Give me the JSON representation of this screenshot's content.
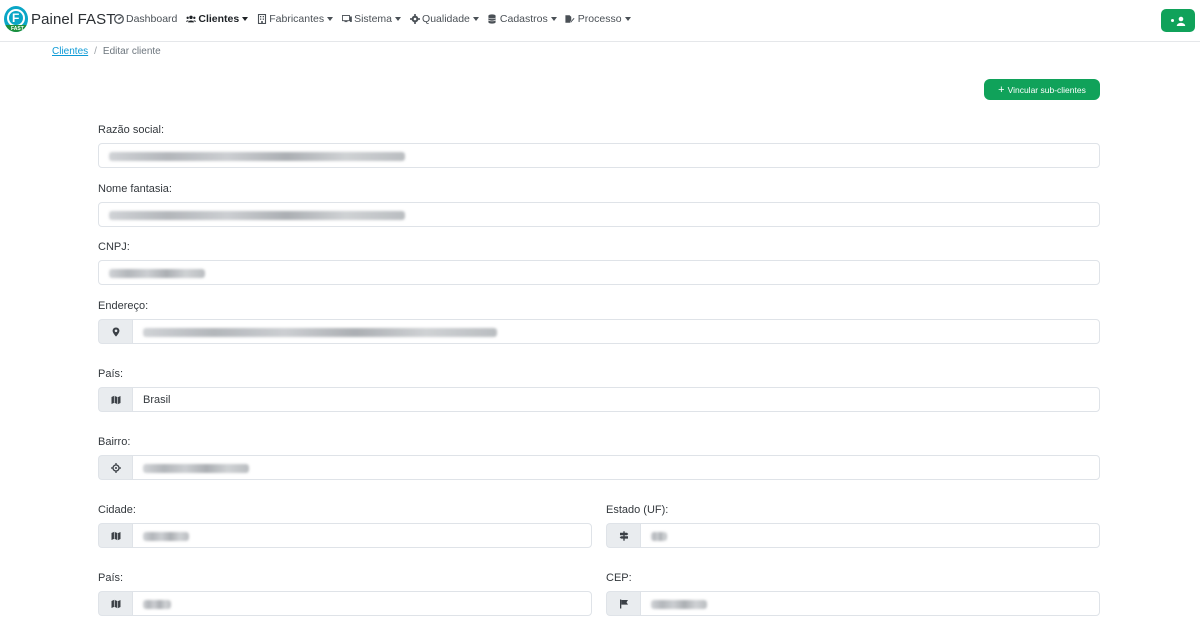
{
  "brand": {
    "name": "Painel FAST",
    "logo_letter": "F",
    "logo_small": "FAST"
  },
  "nav": [
    {
      "label": "Dashboard",
      "icon": "gauge-icon",
      "dropdown": false,
      "active": false
    },
    {
      "label": "Clientes",
      "icon": "users-icon",
      "dropdown": true,
      "active": true
    },
    {
      "label": "Fabricantes",
      "icon": "building-icon",
      "dropdown": true,
      "active": false
    },
    {
      "label": "Sistema",
      "icon": "monitor-icon",
      "dropdown": true,
      "active": false
    },
    {
      "label": "Qualidade",
      "icon": "gear-icon",
      "dropdown": true,
      "active": false
    },
    {
      "label": "Cadastros",
      "icon": "database-icon",
      "dropdown": true,
      "active": false
    },
    {
      "label": "Processo",
      "icon": "file-edit-icon",
      "dropdown": true,
      "active": false
    }
  ],
  "user_button": {
    "icon": "user-icon"
  },
  "breadcrumb": {
    "link": "Clientes",
    "separator": "/",
    "current": "Editar cliente"
  },
  "actions": {
    "link_subclients": "Vincular sub-clientes"
  },
  "form": {
    "razao_social_label": "Razão social:",
    "nome_fantasia_label": "Nome fantasia:",
    "cnpj_label": "CNPJ:",
    "endereco_label": "Endereço:",
    "pais_label": "País:",
    "pais_value": "Brasil",
    "bairro_label": "Bairro:",
    "cidade_label": "Cidade:",
    "estado_label": "Estado (UF):",
    "pais2_label": "País:",
    "cep_label": "CEP:"
  },
  "colors": {
    "primary_green": "#10a25a",
    "link_blue": "#0d9ad6",
    "logo_cyan": "#0aa6c6"
  }
}
